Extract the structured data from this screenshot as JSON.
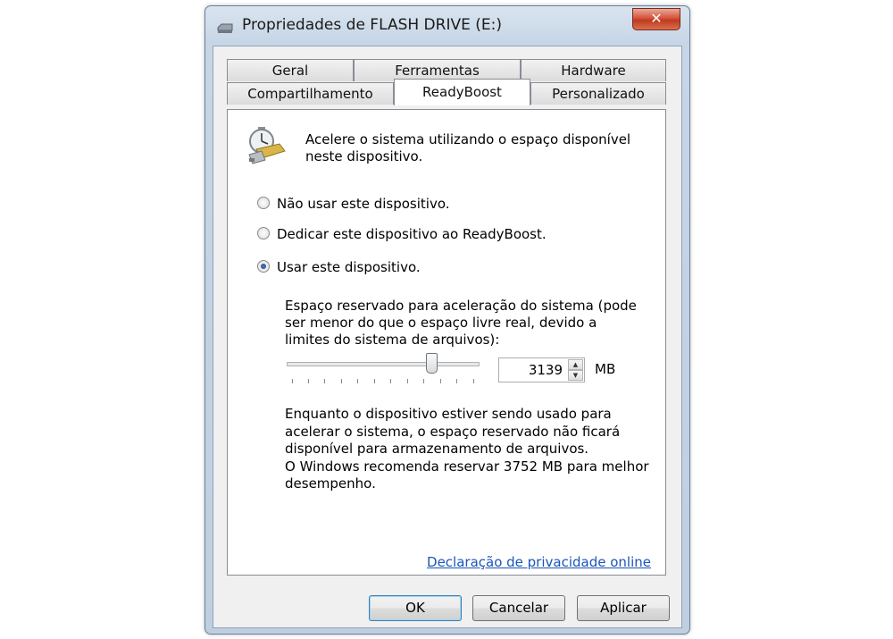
{
  "window": {
    "title": "Propriedades de FLASH DRIVE (E:)",
    "close_label": "✕",
    "title_icon": "drive-icon"
  },
  "tabs_row1": [
    {
      "label": "Geral"
    },
    {
      "label": "Ferramentas"
    },
    {
      "label": "Hardware"
    }
  ],
  "tabs_row2": [
    {
      "label": "Compartilhamento"
    },
    {
      "label": "ReadyBoost",
      "active": true
    },
    {
      "label": "Personalizado"
    }
  ],
  "readyboost": {
    "icon": "readyboost-stopwatch-icon",
    "intro": "Acelere o sistema utilizando o espaço disponível neste dispositivo.",
    "options": [
      {
        "label": "Não usar este dispositivo.",
        "checked": false
      },
      {
        "label": "Dedicar este dispositivo ao ReadyBoost.",
        "checked": false
      },
      {
        "label": "Usar este dispositivo.",
        "checked": true
      }
    ],
    "reserve_text": "Espaço reservado para aceleração do sistema (pode ser menor do que o espaço livre real, devido a limites do sistema de arquivos):",
    "slider_level": 0.77,
    "reserve_value": "3139",
    "unit": "MB",
    "warning_line1": "Enquanto o dispositivo estiver sendo usado para acelerar o sistema, o espaço reservado não ficará disponível para armazenamento de arquivos.",
    "warning_line2": "O Windows recomenda reservar 3752 MB para melhor desempenho.",
    "privacy_link": "Declaração de privacidade online"
  },
  "buttons": {
    "ok": "OK",
    "cancel": "Cancelar",
    "apply": "Aplicar"
  }
}
